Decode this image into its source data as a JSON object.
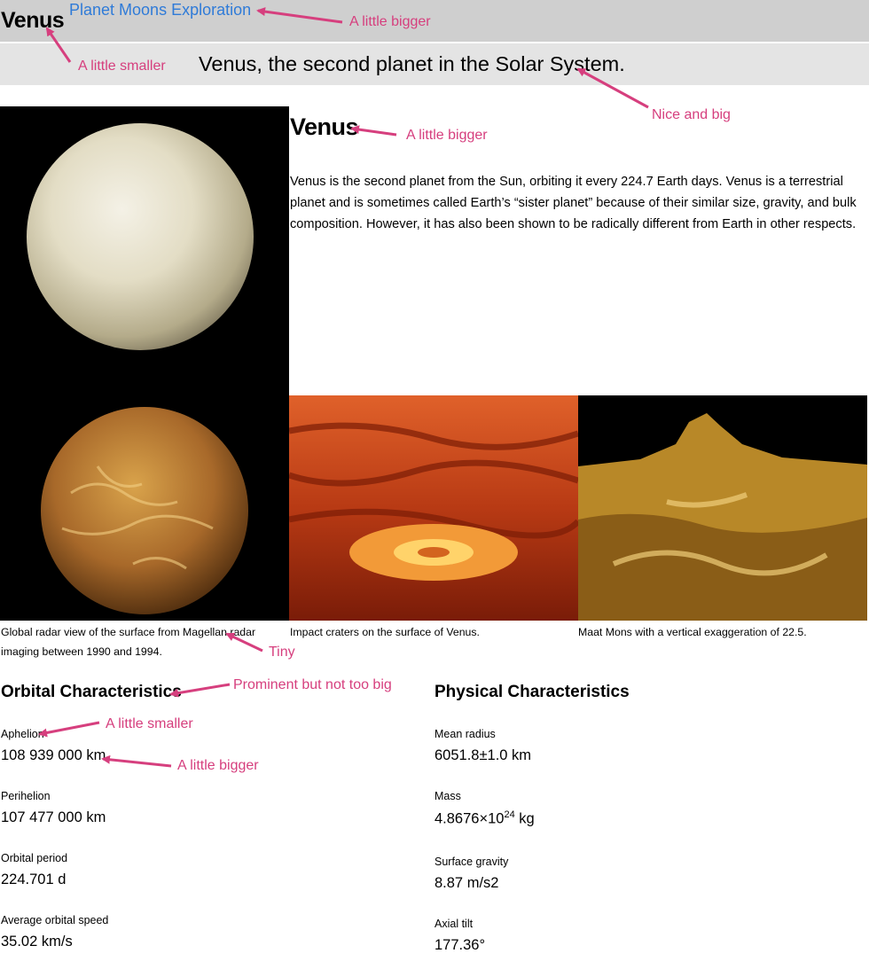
{
  "header": {
    "site_name": "Venus",
    "link_label": "Planet Moons Exploration",
    "tagline": "Venus, the second planet in the Solar System."
  },
  "article": {
    "title": "Venus",
    "body": "Venus is the second planet from the Sun, orbiting it every 224.7 Earth days. Venus is a terrestrial planet and is sometimes called Earth’s “sister planet” because of their similar size, gravity, and bulk composition. However, it has also been shown to be radically different from Earth in other respects."
  },
  "gallery": [
    {
      "caption": "Global radar view of the surface from Magellan radar imaging between 1990 and 1994."
    },
    {
      "caption": "Impact craters on the surface of Venus."
    },
    {
      "caption": "Maat Mons with a vertical exaggeration of 22.5."
    }
  ],
  "orbital": {
    "title": "Orbital Characteristics",
    "items": [
      {
        "label": "Aphelion",
        "value": "108 939 000 km"
      },
      {
        "label": "Perihelion",
        "value": "107 477 000 km"
      },
      {
        "label": "Orbital period",
        "value": "224.701 d"
      },
      {
        "label": "Average orbital speed",
        "value": "35.02 km/s"
      }
    ]
  },
  "physical": {
    "title": "Physical Characteristics",
    "items": [
      {
        "label": "Mean radius",
        "value": "6051.8±1.0 km"
      },
      {
        "label": "Mass",
        "value_main": "4.8676×10",
        "value_exp": "24",
        "value_unit": " kg"
      },
      {
        "label": "Surface gravity",
        "value": "8.87 m/s2"
      },
      {
        "label": "Axial tilt",
        "value": "177.36°"
      }
    ]
  },
  "annotations": {
    "a1": "A little bigger",
    "a2": "A little smaller",
    "a3": "Nice and big",
    "a4": "A little bigger",
    "a5": "Tiny",
    "a6": "Prominent but not too big",
    "a7": "A little smaller",
    "a8": "A little bigger",
    "color": "#d63f7e"
  },
  "colors": {
    "header_bg": "#cfcfcf",
    "tagline_bg": "#e4e4e4",
    "link": "#2f7bd8"
  }
}
